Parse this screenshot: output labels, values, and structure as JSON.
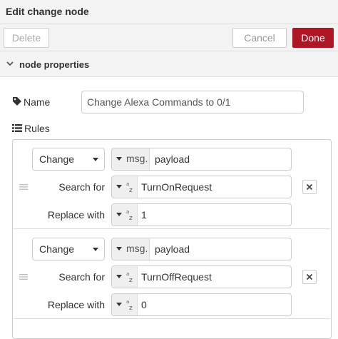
{
  "window": {
    "title": "Edit change node"
  },
  "toolbar": {
    "delete_label": "Delete",
    "cancel_label": "Cancel",
    "done_label": "Done",
    "done_color": "#ad1625"
  },
  "section": {
    "label": "node properties",
    "icon": "chevron-down-icon"
  },
  "name": {
    "label": "Name",
    "value": "Change Alexa Commands to 0/1",
    "icon": "tag-icon"
  },
  "rules": {
    "label": "Rules",
    "icon": "list-icon",
    "items": [
      {
        "action": "Change",
        "target_prefix": "msg.",
        "target": "payload",
        "search_label": "Search for",
        "search_value": "TurnOnRequest",
        "replace_label": "Replace with",
        "replace_value": "1"
      },
      {
        "action": "Change",
        "target_prefix": "msg.",
        "target": "payload",
        "search_label": "Search for",
        "search_value": "TurnOffRequest",
        "replace_label": "Replace with",
        "replace_value": "0"
      }
    ]
  }
}
